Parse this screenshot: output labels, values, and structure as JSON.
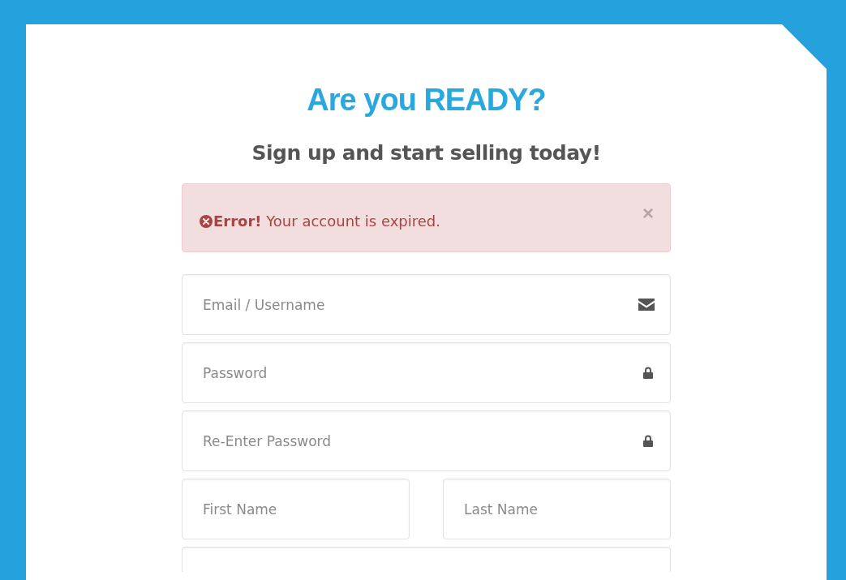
{
  "heading": "Are you READY?",
  "subheading": "Sign up and start selling today!",
  "alert": {
    "kind": "error",
    "title": "Error!",
    "message": "Your account is expired.",
    "dismiss": "×"
  },
  "fields": [
    {
      "kind": "email",
      "placeholder": "Email / Username"
    },
    {
      "kind": "password",
      "placeholder": "Password"
    },
    {
      "kind": "password",
      "placeholder": "Re-Enter Password"
    }
  ],
  "name_row": [
    {
      "kind": "text",
      "placeholder": "First Name"
    },
    {
      "kind": "text",
      "placeholder": "Last Name"
    }
  ],
  "more_fields": [
    {
      "kind": "text"
    }
  ]
}
